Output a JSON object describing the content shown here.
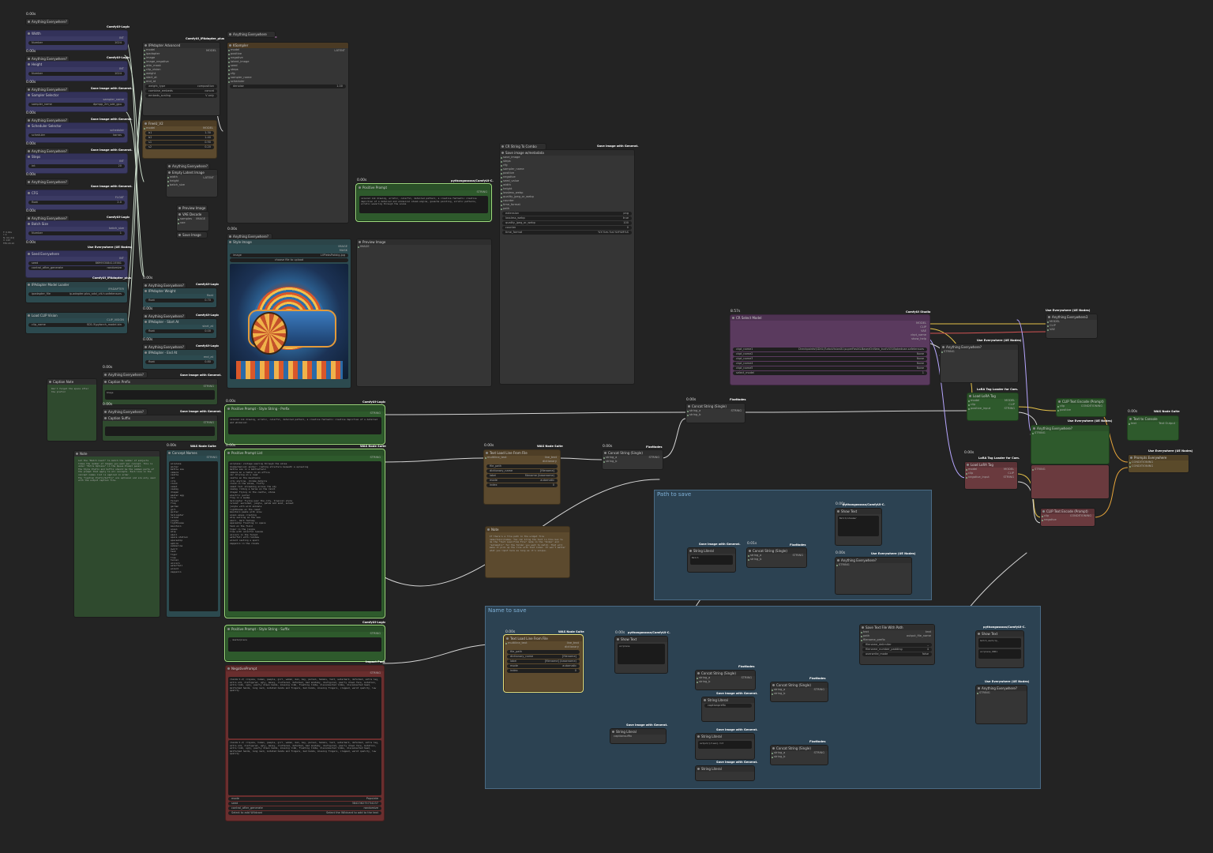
{
  "groups": {
    "path_to_save": "Path to save",
    "name_to_save": "Name to save"
  },
  "side_note": "T: 0.00s\nI: 0\nN: 41 [41]\nV: 140\nFPS:29.10",
  "timing": "0.00s",
  "timing_clip": "8.57s",
  "timing_concat": "0.01s",
  "tags": {
    "logic": "ComfyUI-Logic",
    "ipadapter": "ComfyUI_IPAdapter_plus",
    "save_image": "Save Image with Generat.",
    "use_everywhere": "Use Everywhere (UE Nodes)",
    "fiz": "FizzNodes",
    "was": "WAS Node Suite",
    "pysss": "pythongosssss/ComfyUI-C.",
    "studio": "ComfyUI Studio",
    "lora_tag": "LoRA Tag Loader for Com.",
    "impact": "Impact Pack"
  },
  "left_column": {
    "width": {
      "ae": "Anything Everywhere?",
      "title": "Width",
      "type": "INT",
      "widget": "Number",
      "value": "1024"
    },
    "height": {
      "ae": "Anything Everywhere?",
      "title": "Height",
      "type": "INT",
      "widget": "Number",
      "value": "1024"
    },
    "sampler": {
      "ae": "Anything Everywhere?",
      "title": "Sampler Selector",
      "out": "sampler_name",
      "widget": "sampler_name",
      "value": "dpmpp_2m_sde_gpu"
    },
    "scheduler": {
      "ae": "Anything Everywhere?",
      "title": "Scheduler Selector",
      "out": "scheduler",
      "widget": "scheduler",
      "value": "karras"
    },
    "steps": {
      "ae": "Anything Everywhere?",
      "title": "Steps",
      "type": "INT",
      "widget": "int",
      "value": "20"
    },
    "cfg": {
      "ae": "Anything Everywhere?",
      "title": "CFG",
      "type": "FLOAT",
      "widget": "float",
      "value": "2.0"
    },
    "batch": {
      "ae": "Anything Everywhere?",
      "title": "Batch Size",
      "out": "batch_size",
      "widget": "Number",
      "value": "1"
    },
    "seed": {
      "title": "Seed Everywhere",
      "type": "INT",
      "w1": "seed",
      "v1": "869953084115581",
      "w2": "control_after_generate",
      "v2": "randomize"
    },
    "ipa_model": {
      "title": "IPAdapter Model Loader",
      "out": "IPADAPTER",
      "widget": "ipadapter_file",
      "value": "ip-adapter-plus_sdxl_vit-h.safetensors"
    },
    "clip_vision": {
      "title": "Load CLIP Vision",
      "out": "CLIP_VISION",
      "widget": "clip_name",
      "value": "SD1.5\\pytorch_model.bin"
    }
  },
  "ipa_adv": {
    "title": "IPAdapter Advanced",
    "out": "MODEL",
    "inputs": [
      "model",
      "ipadapter",
      "image",
      "image_negative",
      "attn_mask",
      "clip_vision",
      "weight",
      "start_at",
      "end_at"
    ],
    "widgets": [
      [
        "weight_type",
        "composition"
      ],
      [
        "combine_embeds",
        "concat"
      ],
      [
        "embeds_scaling",
        "V only"
      ]
    ]
  },
  "freeu": {
    "title": "FreeU_V2",
    "in": "model",
    "out": "MODEL",
    "widgets": [
      [
        "b1",
        "1.30"
      ],
      [
        "b2",
        "1.40"
      ],
      [
        "s1",
        "0.90"
      ],
      [
        "s2",
        "0.20"
      ]
    ]
  },
  "empty_latent": {
    "ae": "Anything Everywhere?",
    "title": "Empty Latent Image",
    "inputs": [
      "width",
      "height",
      "batch_size"
    ],
    "out": "LATENT"
  },
  "vae_decode": {
    "title1": "Preview Image",
    "title2": "VAE Decode",
    "inputs": [
      "samples",
      "vae"
    ],
    "out": "IMAGE",
    "save": "Save Image"
  },
  "ipa_weight": {
    "ae": "Anything Everywhere?",
    "title": "IPAdapter Weight",
    "out": "float",
    "widget": "float",
    "value": "0.70"
  },
  "ipa_start": {
    "ae": "Anything Everywhere?",
    "title": "IPAdapter - Start At",
    "out": "start_at",
    "widget": "float",
    "value": "0.00"
  },
  "ipa_end": {
    "ae": "Anything Everywhere?",
    "title": "IPAdapter - End At",
    "out": "end_at",
    "widget": "float",
    "value": "0.80"
  },
  "ksampler": {
    "ae": "Anything Everywhere",
    "title": "KSampler",
    "out": "LATENT",
    "inputs": [
      "model",
      "positive",
      "negative",
      "latent_image",
      "seed",
      "steps",
      "cfg",
      "sampler_name",
      "scheduler",
      "denoise"
    ],
    "widget": "denoise",
    "value": "1.00"
  },
  "style_image": {
    "ae": "Anything Everywhere?",
    "title": "Style Image",
    "outs": [
      "IMAGE",
      "MASK"
    ],
    "widget": "image",
    "value": "LilPlebsPakbig.jpg",
    "upload": "choose file to upload"
  },
  "pos_prompt": {
    "title": "Positive Prompt",
    "out": "STRING",
    "text": "colored ink drawing, erratic, colorful, detailed pattern, a creative fantastic creative depiction of a detailed and whimsical steam engine, gouache painting, erratic patterns, erratic wavering through the scene"
  },
  "preview": {
    "title": "Preview Image",
    "in": "IMAGE"
  },
  "clip_combo": {
    "title": "CR String To Combo"
  },
  "save_image": {
    "title": "Save image w/metadata",
    "inputs": [
      "save_image",
      "steps",
      "cfg",
      "sampler_name",
      "positive",
      "negative",
      "seed_value",
      "width",
      "height",
      "lossless_webp",
      "quality_jpeg_or_webp",
      "counter",
      "time_format",
      "path"
    ],
    "widgets": [
      [
        "extension",
        "png"
      ],
      [
        "lossless_webp",
        "true"
      ],
      [
        "quality_jpeg_or_webp",
        "100"
      ],
      [
        "counter",
        "0"
      ],
      [
        "time_format",
        "%Y-%m-%d-%H%M%S"
      ]
    ]
  },
  "caption_note": {
    "title": "Caption Note",
    "text": "Don't forget the space after the prefix!"
  },
  "caption_prefix": {
    "ae": "Anything Everywhere?",
    "title": "Caption Prefix",
    "out": "STRING",
    "value": "Image"
  },
  "caption_suffix": {
    "ae": "Anything Everywhere?",
    "title": "Caption Suffix",
    "out": "STRING",
    "value": ""
  },
  "pps_prefix": {
    "title": "Positive Prompt - Style String - Prefix",
    "out": "STRING",
    "text": "colored ink drawing, erratic, colorful, detailed pattern, a creative fantastic creative depiction of a detailed and whimsical"
  },
  "pps_suffix": {
    "title": "Positive Prompt - Style String - Suffix",
    "out": "STRING",
    "text": ", masterpiece"
  },
  "note_main": {
    "title": "Note",
    "text": "Let the \"Batch Count\" to match the number of subjects times the number of images you want per concept. This is under \"Extra Options\" in the Queue Prompt panel.\nThe Style Prefix and Suffix should be the common parts of the prompt that apply to all concepts. Each line in the concept names list is applied in order.\nThe \"Caption Prefix/Suffix\" are optional and are only used with the output caption file."
  },
  "concept_names": {
    "title": "Concept Names",
    "out": "STRING",
    "list": [
      "airplane",
      "anchor",
      "battle axe",
      "camera",
      "castle",
      "cat",
      "city",
      "cloud",
      "comet",
      "cowboy",
      "dragon",
      "easter egg",
      "fire",
      "forest",
      "frog",
      "garden",
      "girl",
      "guitar",
      "helicopter",
      "island",
      "jungle",
      "lighthouse",
      "mountain",
      "ocean",
      "ship",
      "skull",
      "space station",
      "spaceship",
      "sphinx",
      "submarine",
      "sword",
      "tank",
      "tiger",
      "tree",
      "tunnel",
      "unicorn",
      "waterfall",
      "wizard",
      "zeppelin"
    ]
  },
  "pos_list": {
    "title": "Positive Prompt List",
    "out": "STRING",
    "text": "airplane: vintage soaring through the skies\nbiomechanical anchor: rusting structure beneath a sprawling\nbattle axe in a battlefield\ncamera on a table in an office\ncar driving on a road\ncastle on the mountains\ncity skyline, chrome details\ncloud in the skies, fluffy\ncomet tail streaking across the sky\ncowboy riding a horse on the ranch\ndragon flying in the castle, stone\nelectric guitar\nfrog in a swamp\nhelicopter flying over the city, tropical style\nisland: secluded, jungle, palms and sand, sunset\njungle with wild animals\nlighthouse on the coast\nmountain peaks with snow\nocean waves crashing\nship sailing on the sea\nskull, dark fantasy\nspaceship floating in space\ntank on the field\ntiger in the jungle\ntree with colorful leaves\nunicorn in the forest\nwaterfall with rainbow\nwizard casting a spell\nzeppelin in the clouds"
  },
  "neg_prompt": {
    "title": "NegativePrompt",
    "out": "STRING",
    "text": "(hands:1.2) crayons, human, people, girl, woman, man, boy, person, humans, text, watermark, deformed, extra leg, extra arm, disfigured, ugly, messy, cluttered, deformed, bad anatomy, disfigured, poorly drawn face, mutation, extra limb, ugly, poorly drawn hands, missing limb, floating limbs, disconnected limbs, disconnected head, malformed hands, long neck, mutated hands and fingers, bad hands, missing fingers, cropped, worst quality, low quality",
    "widgets": [
      [
        "mode",
        "Populate"
      ],
      [
        "seed",
        "384236275734237"
      ],
      [
        "control_after_generate",
        "randomize"
      ],
      [
        "Select to add Wildcard",
        "Select the Wildcard to add to the text"
      ]
    ]
  },
  "text_load_1": {
    "title": "Text Load Line From File",
    "outs": [
      "line_text",
      "dictionary"
    ],
    "in": "multiline_text",
    "widgets": [
      [
        "file_path",
        ""
      ],
      [
        "dictionary_name",
        "[filename]"
      ],
      [
        "label",
        "filename (basename)"
      ],
      [
        "mode",
        "automatic"
      ],
      [
        "index",
        "0"
      ]
    ]
  },
  "concat_1": {
    "title": "Concat String (Single)",
    "inputs": [
      "string_a",
      "string_b"
    ],
    "out": "STRING"
  },
  "concat_2": {
    "title": "Concat String (Single)",
    "inputs": [
      "string_a",
      "string_b"
    ],
    "out": "STRING"
  },
  "note_2": {
    "title": "Note",
    "text": "If there's a file path in the widget file name/topic/names. You can bring the text in this box to do the \"Text Load From File\" node in the \"Index\" and \"automatic\" for the folder you want to match. That will make it pick up the line with that index. It won't matter what you input here as long as it's unique."
  },
  "cr_select": {
    "title": "CR Select Model",
    "outs": [
      "MODEL",
      "CLIP",
      "VAE",
      "ckpt_name",
      "show_help"
    ],
    "widgets": [
      [
        "ckpt_name1",
        "Checkpoints\\SDXL\\TurboVisionXL\\superFastXLBasedOnNew_tvxlV431Bakedvae.safetensors"
      ],
      [
        "ckpt_name2",
        "None"
      ],
      [
        "ckpt_name3",
        "None"
      ],
      [
        "ckpt_name4",
        "None"
      ],
      [
        "ckpt_name5",
        "None"
      ],
      [
        "select_model",
        "1"
      ]
    ]
  },
  "ae_model": {
    "title": "Anything Everywhere3",
    "inputs": [
      "MODEL",
      "CLIP",
      "VAE"
    ]
  },
  "ae_string": {
    "title": "Anything Everywhere?",
    "in": "STRING"
  },
  "lora_1": {
    "title": "Load LoRA Tag",
    "inputs": [
      "model",
      "clip",
      "positive_input"
    ],
    "outs": [
      "MODEL",
      "CLIP",
      "STRING"
    ]
  },
  "lora_2": {
    "title": "Load LoRA Tag",
    "inputs": [
      "model",
      "clip",
      "negative_input"
    ],
    "outs": [
      "MODEL",
      "CLIP",
      "STRING"
    ]
  },
  "clip_enc_pos": {
    "title": "CLIP Text Encode (Prompt)",
    "inputs": [
      "clip",
      "positive"
    ],
    "out": "CONDITIONING"
  },
  "clip_enc_neg": {
    "title": "CLIP Text Encode (Prompt)",
    "inputs": [
      "clip",
      "negative"
    ],
    "out": "CONDITIONING"
  },
  "ae_pos": {
    "title": "Anything Everywhere?",
    "in": "STRING"
  },
  "ae_neg": {
    "title": "Anything Everywhere?",
    "in": "STRING"
  },
  "prompts_ae": {
    "title": "Prompts Everywhere",
    "inputs": [
      "CONDITIONING",
      "CONDITIONING"
    ]
  },
  "text_to_console": {
    "title": "Text to Console",
    "in": "text",
    "out": "Text Output"
  },
  "path_nodes": {
    "string_literal": {
      "title": "String Literal",
      "value": "Batch"
    },
    "concat": {
      "title": "Concat String (Single)",
      "inputs": [
        "string_a",
        "string_b"
      ],
      "out": "STRING"
    },
    "show_text": {
      "title": "Show Text",
      "value": "Batch/steamer"
    },
    "ae": {
      "title": "Anything Everywhere?",
      "in": "STRING"
    }
  },
  "name_nodes": {
    "text_load": {
      "title": "Text Load Line From File",
      "in": "multiline_text",
      "outs": [
        "line_text",
        "dictionary"
      ],
      "widgets": [
        [
          "file_path",
          ""
        ],
        [
          "dictionary_name",
          "[filename]"
        ],
        [
          "label",
          "[filename] (basename)"
        ],
        [
          "mode",
          "automatic"
        ],
        [
          "index",
          "0"
        ]
      ]
    },
    "show_text_a": {
      "title": "Show Text",
      "value": "airplane"
    },
    "concat_a": {
      "title": "Concat String (Single)"
    },
    "concat_b": {
      "title": "Concat String (Single)"
    },
    "concat_c": {
      "title": "Concat String (Single)"
    },
    "lit_caption": {
      "title": "String Literal",
      "value": "captionprefix"
    },
    "lit_caption2": {
      "title": "String Literal",
      "value": "captionsuffix"
    },
    "lit_output": {
      "title": "String Literal",
      "value": "output/{clean}.txt"
    },
    "lit_empty": {
      "title": "String Literal",
      "value": ""
    },
    "save_text": {
      "title": "Save Text File With Path",
      "inputs": [
        "text",
        "path",
        "filename_prefix"
      ],
      "outs": [
        "text",
        "output_file_name"
      ],
      "widgets": [
        [
          "filename_delimiter",
          "_"
        ],
        [
          "filename_number_padding",
          "4"
        ],
        [
          "overwrite_mode",
          "false"
        ]
      ]
    },
    "show_text_b": {
      "title": "Show Text",
      "value": "batch_each/ip_"
    },
    "show_text_c": {
      "value": "airplane_0001"
    },
    "ae": {
      "title": "Anything Everywhere?",
      "in": "STRING"
    }
  }
}
